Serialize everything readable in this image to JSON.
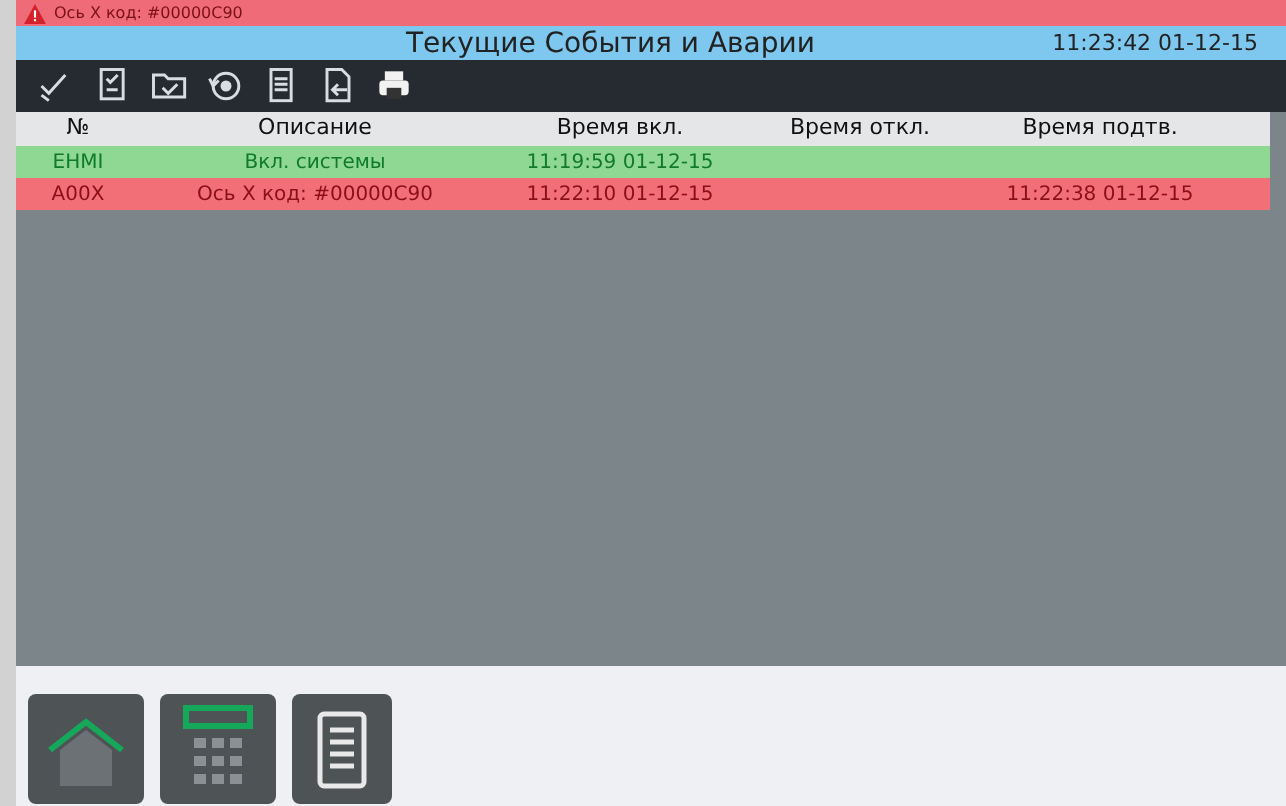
{
  "alarm_banner": {
    "text": "Ось X код: #00000C90"
  },
  "header": {
    "title": "Текущие События и Аварии",
    "clock": "11:23:42 01-12-15"
  },
  "table": {
    "columns": [
      "№",
      "Описание",
      "Время вкл.",
      "Время откл.",
      "Время подтв."
    ],
    "rows": [
      {
        "kind": "event",
        "cells": [
          "EHMI",
          "Вкл. системы",
          "11:19:59 01-12-15",
          "",
          ""
        ]
      },
      {
        "kind": "alarm",
        "cells": [
          "A00X",
          "Ось X код: #00000C90",
          "11:22:10 01-12-15",
          "",
          "11:22:38 01-12-15"
        ]
      }
    ]
  }
}
